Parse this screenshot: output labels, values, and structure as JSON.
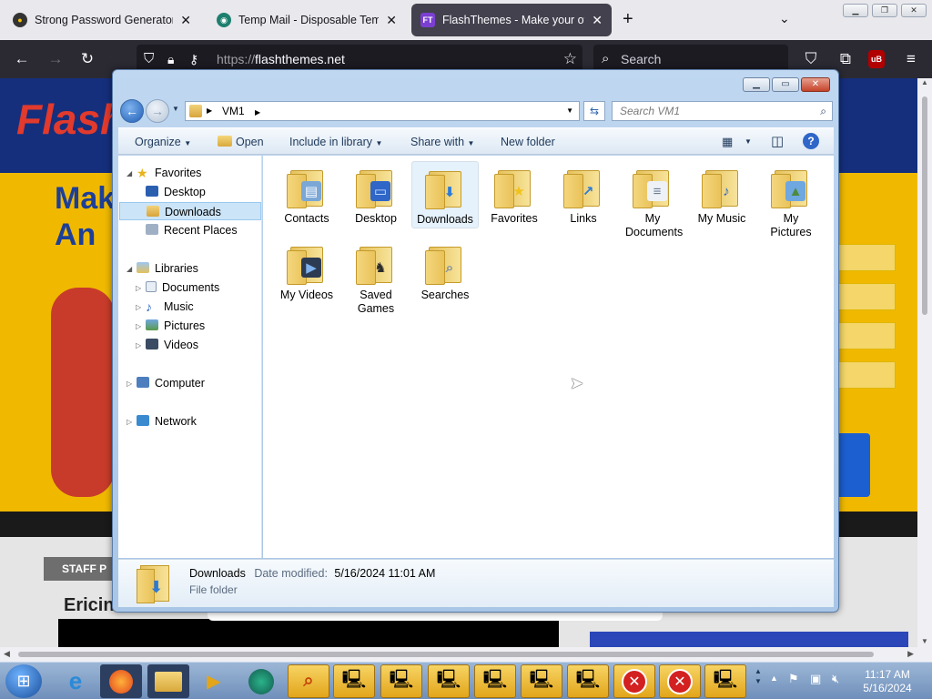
{
  "browser": {
    "tabs": [
      {
        "label": "Strong Password Generator",
        "active": false
      },
      {
        "label": "Temp Mail - Disposable Tempo",
        "active": false
      },
      {
        "label": "FlashThemes - Make your own",
        "active": true
      }
    ],
    "new_tab": "+",
    "url_protocol": "https://",
    "url_host": "flashthemes.net",
    "search_placeholder": "Search",
    "ext_badge": "uB"
  },
  "website": {
    "logo": "Flash",
    "headline_1": "Mak",
    "headline_2": "An",
    "staff_label": "STAFF P",
    "name": "Ericin"
  },
  "explorer": {
    "address_path": "VM1",
    "search_placeholder": "Search VM1",
    "toolbar": {
      "organize": "Organize",
      "open": "Open",
      "include_in_library": "Include in library",
      "share_with": "Share with",
      "new_folder": "New folder"
    },
    "nav": {
      "favorites": "Favorites",
      "desktop": "Desktop",
      "downloads": "Downloads",
      "recent_places": "Recent Places",
      "libraries": "Libraries",
      "documents": "Documents",
      "music": "Music",
      "pictures": "Pictures",
      "videos": "Videos",
      "computer": "Computer",
      "network": "Network"
    },
    "items": [
      {
        "label": "Contacts",
        "icon": "contacts-icon"
      },
      {
        "label": "Desktop",
        "icon": "desktop-icon"
      },
      {
        "label": "Downloads",
        "icon": "download-arrow-icon",
        "selected": true
      },
      {
        "label": "Favorites",
        "icon": "star-icon"
      },
      {
        "label": "Links",
        "icon": "link-arrow-icon"
      },
      {
        "label": "My Documents",
        "icon": "document-icon"
      },
      {
        "label": "My Music",
        "icon": "music-note-icon"
      },
      {
        "label": "My Pictures",
        "icon": "picture-icon"
      },
      {
        "label": "My Videos",
        "icon": "film-icon"
      },
      {
        "label": "Saved Games",
        "icon": "chess-piece-icon"
      },
      {
        "label": "Searches",
        "icon": "magnifier-icon"
      }
    ],
    "details": {
      "name": "Downloads",
      "modified_label": "Date modified:",
      "modified_value": "5/16/2024 11:01 AM",
      "type": "File folder"
    }
  },
  "taskbar": {
    "time": "11:17 AM",
    "date": "5/16/2024"
  }
}
